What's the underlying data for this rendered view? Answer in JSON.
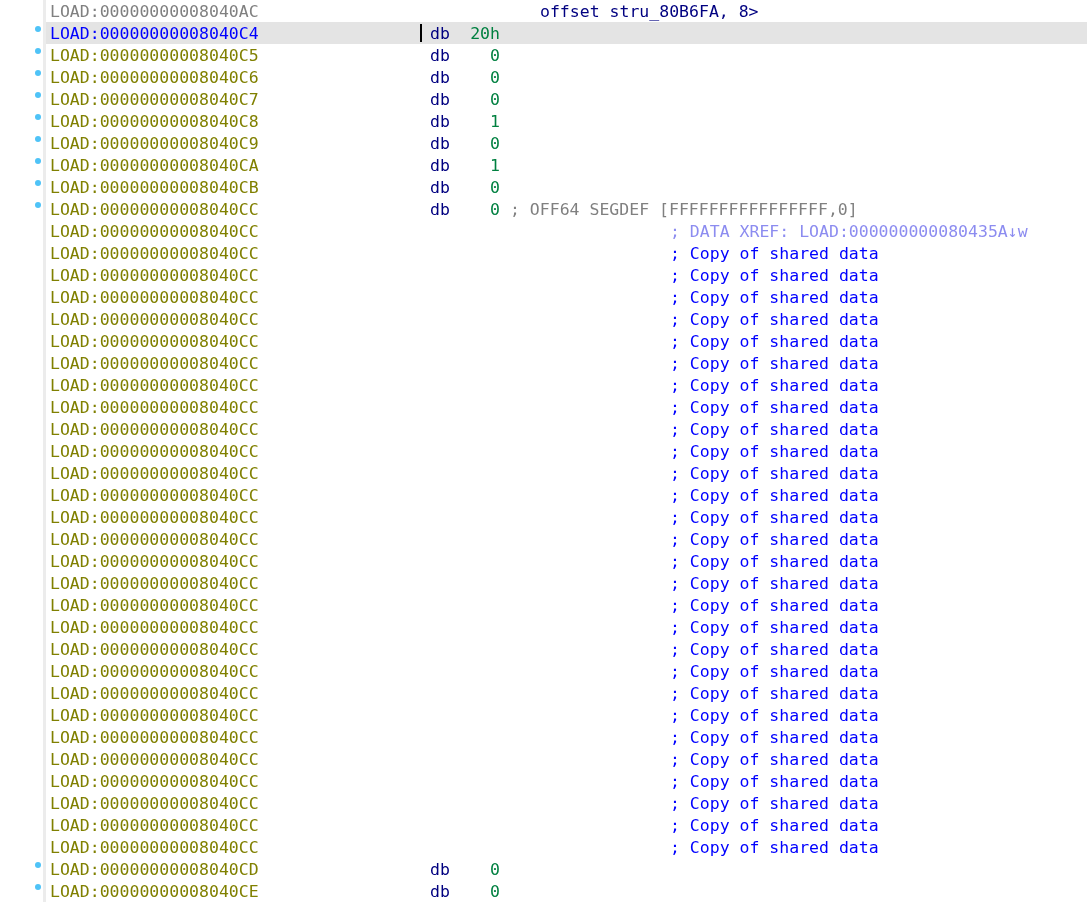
{
  "lines": [
    {
      "kind": "continuation",
      "address": "LOAD:00000000008040AC",
      "marked": false,
      "selected": false,
      "text": "offset stru_80B6FA, 8>"
    },
    {
      "kind": "instruction",
      "address": "LOAD:00000000008040C4",
      "marked": true,
      "selected": true,
      "mnemonic": "db",
      "operand": "20h"
    },
    {
      "kind": "instruction",
      "address": "LOAD:00000000008040C5",
      "marked": true,
      "selected": false,
      "mnemonic": "db",
      "operand": "0"
    },
    {
      "kind": "instruction",
      "address": "LOAD:00000000008040C6",
      "marked": true,
      "selected": false,
      "mnemonic": "db",
      "operand": "0"
    },
    {
      "kind": "instruction",
      "address": "LOAD:00000000008040C7",
      "marked": true,
      "selected": false,
      "mnemonic": "db",
      "operand": "0"
    },
    {
      "kind": "instruction",
      "address": "LOAD:00000000008040C8",
      "marked": true,
      "selected": false,
      "mnemonic": "db",
      "operand": "1"
    },
    {
      "kind": "instruction",
      "address": "LOAD:00000000008040C9",
      "marked": true,
      "selected": false,
      "mnemonic": "db",
      "operand": "0"
    },
    {
      "kind": "instruction",
      "address": "LOAD:00000000008040CA",
      "marked": true,
      "selected": false,
      "mnemonic": "db",
      "operand": "1"
    },
    {
      "kind": "instruction",
      "address": "LOAD:00000000008040CB",
      "marked": true,
      "selected": false,
      "mnemonic": "db",
      "operand": "0"
    },
    {
      "kind": "instruction",
      "address": "LOAD:00000000008040CC",
      "marked": true,
      "selected": false,
      "mnemonic": "db",
      "operand": "0",
      "comment": {
        "kind": "auto",
        "text": "; OFF64 SEGDEF [FFFFFFFFFFFFFFFF,0]"
      }
    },
    {
      "kind": "comment",
      "address": "LOAD:00000000008040CC",
      "marked": false,
      "selected": false,
      "comment": {
        "kind": "xref",
        "text": "; DATA XREF: LOAD:000000000080435A↓w"
      }
    },
    {
      "kind": "comment",
      "address": "LOAD:00000000008040CC",
      "marked": false,
      "selected": false,
      "comment": {
        "kind": "user",
        "text": "; Copy of shared data"
      }
    },
    {
      "kind": "comment",
      "address": "LOAD:00000000008040CC",
      "marked": false,
      "selected": false,
      "comment": {
        "kind": "user",
        "text": "; Copy of shared data"
      }
    },
    {
      "kind": "comment",
      "address": "LOAD:00000000008040CC",
      "marked": false,
      "selected": false,
      "comment": {
        "kind": "user",
        "text": "; Copy of shared data"
      }
    },
    {
      "kind": "comment",
      "address": "LOAD:00000000008040CC",
      "marked": false,
      "selected": false,
      "comment": {
        "kind": "user",
        "text": "; Copy of shared data"
      }
    },
    {
      "kind": "comment",
      "address": "LOAD:00000000008040CC",
      "marked": false,
      "selected": false,
      "comment": {
        "kind": "user",
        "text": "; Copy of shared data"
      }
    },
    {
      "kind": "comment",
      "address": "LOAD:00000000008040CC",
      "marked": false,
      "selected": false,
      "comment": {
        "kind": "user",
        "text": "; Copy of shared data"
      }
    },
    {
      "kind": "comment",
      "address": "LOAD:00000000008040CC",
      "marked": false,
      "selected": false,
      "comment": {
        "kind": "user",
        "text": "; Copy of shared data"
      }
    },
    {
      "kind": "comment",
      "address": "LOAD:00000000008040CC",
      "marked": false,
      "selected": false,
      "comment": {
        "kind": "user",
        "text": "; Copy of shared data"
      }
    },
    {
      "kind": "comment",
      "address": "LOAD:00000000008040CC",
      "marked": false,
      "selected": false,
      "comment": {
        "kind": "user",
        "text": "; Copy of shared data"
      }
    },
    {
      "kind": "comment",
      "address": "LOAD:00000000008040CC",
      "marked": false,
      "selected": false,
      "comment": {
        "kind": "user",
        "text": "; Copy of shared data"
      }
    },
    {
      "kind": "comment",
      "address": "LOAD:00000000008040CC",
      "marked": false,
      "selected": false,
      "comment": {
        "kind": "user",
        "text": "; Copy of shared data"
      }
    },
    {
      "kind": "comment",
      "address": "LOAD:00000000008040CC",
      "marked": false,
      "selected": false,
      "comment": {
        "kind": "user",
        "text": "; Copy of shared data"
      }
    },
    {
      "kind": "comment",
      "address": "LOAD:00000000008040CC",
      "marked": false,
      "selected": false,
      "comment": {
        "kind": "user",
        "text": "; Copy of shared data"
      }
    },
    {
      "kind": "comment",
      "address": "LOAD:00000000008040CC",
      "marked": false,
      "selected": false,
      "comment": {
        "kind": "user",
        "text": "; Copy of shared data"
      }
    },
    {
      "kind": "comment",
      "address": "LOAD:00000000008040CC",
      "marked": false,
      "selected": false,
      "comment": {
        "kind": "user",
        "text": "; Copy of shared data"
      }
    },
    {
      "kind": "comment",
      "address": "LOAD:00000000008040CC",
      "marked": false,
      "selected": false,
      "comment": {
        "kind": "user",
        "text": "; Copy of shared data"
      }
    },
    {
      "kind": "comment",
      "address": "LOAD:00000000008040CC",
      "marked": false,
      "selected": false,
      "comment": {
        "kind": "user",
        "text": "; Copy of shared data"
      }
    },
    {
      "kind": "comment",
      "address": "LOAD:00000000008040CC",
      "marked": false,
      "selected": false,
      "comment": {
        "kind": "user",
        "text": "; Copy of shared data"
      }
    },
    {
      "kind": "comment",
      "address": "LOAD:00000000008040CC",
      "marked": false,
      "selected": false,
      "comment": {
        "kind": "user",
        "text": "; Copy of shared data"
      }
    },
    {
      "kind": "comment",
      "address": "LOAD:00000000008040CC",
      "marked": false,
      "selected": false,
      "comment": {
        "kind": "user",
        "text": "; Copy of shared data"
      }
    },
    {
      "kind": "comment",
      "address": "LOAD:00000000008040CC",
      "marked": false,
      "selected": false,
      "comment": {
        "kind": "user",
        "text": "; Copy of shared data"
      }
    },
    {
      "kind": "comment",
      "address": "LOAD:00000000008040CC",
      "marked": false,
      "selected": false,
      "comment": {
        "kind": "user",
        "text": "; Copy of shared data"
      }
    },
    {
      "kind": "comment",
      "address": "LOAD:00000000008040CC",
      "marked": false,
      "selected": false,
      "comment": {
        "kind": "user",
        "text": "; Copy of shared data"
      }
    },
    {
      "kind": "comment",
      "address": "LOAD:00000000008040CC",
      "marked": false,
      "selected": false,
      "comment": {
        "kind": "user",
        "text": "; Copy of shared data"
      }
    },
    {
      "kind": "comment",
      "address": "LOAD:00000000008040CC",
      "marked": false,
      "selected": false,
      "comment": {
        "kind": "user",
        "text": "; Copy of shared data"
      }
    },
    {
      "kind": "comment",
      "address": "LOAD:00000000008040CC",
      "marked": false,
      "selected": false,
      "comment": {
        "kind": "user",
        "text": "; Copy of shared data"
      }
    },
    {
      "kind": "comment",
      "address": "LOAD:00000000008040CC",
      "marked": false,
      "selected": false,
      "comment": {
        "kind": "user",
        "text": "; Copy of shared data"
      }
    },
    {
      "kind": "comment",
      "address": "LOAD:00000000008040CC",
      "marked": false,
      "selected": false,
      "comment": {
        "kind": "user",
        "text": "; Copy of shared data"
      }
    },
    {
      "kind": "instruction",
      "address": "LOAD:00000000008040CD",
      "marked": true,
      "selected": false,
      "mnemonic": "db",
      "operand": "0"
    },
    {
      "kind": "instruction",
      "address": "LOAD:00000000008040CE",
      "marked": true,
      "selected": false,
      "mnemonic": "db",
      "operand": "0"
    }
  ]
}
